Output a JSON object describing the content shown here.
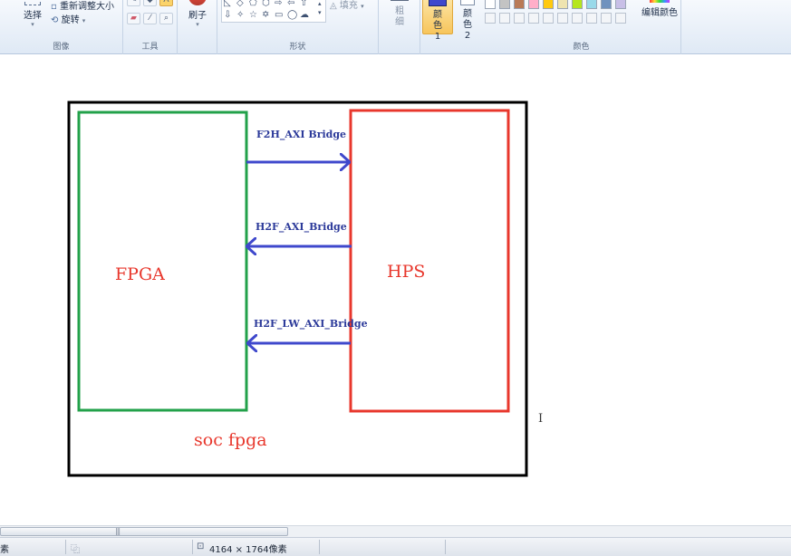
{
  "ribbon": {
    "image_group": {
      "label": "图像",
      "select_label": "选择",
      "resize_label": "重新调整大小",
      "rotate_label": "旋转"
    },
    "tools_group": {
      "label": "工具"
    },
    "brush_label": "刷子",
    "shapes_group": {
      "label": "形状",
      "fill_label": "填充"
    },
    "size_label": "粗细",
    "color1_label": "颜色 1",
    "color2_label": "颜色 2",
    "colors_group": {
      "label": "颜色",
      "edit_colors_label": "编辑颜色",
      "palette_row1": [
        "#ffffff",
        "#c3c3c3",
        "#b97a57",
        "#ffaec9",
        "#ffc90e",
        "#efe4b0",
        "#b5e61d",
        "#99d9ea",
        "#7092be",
        "#c8bfe7"
      ],
      "active_color1": "#3f48cc",
      "active_color2": "#ffffff"
    }
  },
  "diagram": {
    "fpga_label": "FPGA",
    "hps_label": "HPS",
    "bridge1_label": "F2H_AXI Bridge",
    "bridge2_label": "H2F_AXI_Bridge",
    "bridge3_label": "H2F_LW_AXI_Bridge",
    "caption": "soc fpga",
    "colors": {
      "outer": "#000000",
      "fpga": "#22a14a",
      "hps": "#e8372c",
      "arrows": "#3f48cc",
      "text_red": "#e8372c",
      "text_blue": "#2c3a9a"
    }
  },
  "statusbar": {
    "left_text": "素",
    "dimensions": "4164 × 1764像素"
  }
}
